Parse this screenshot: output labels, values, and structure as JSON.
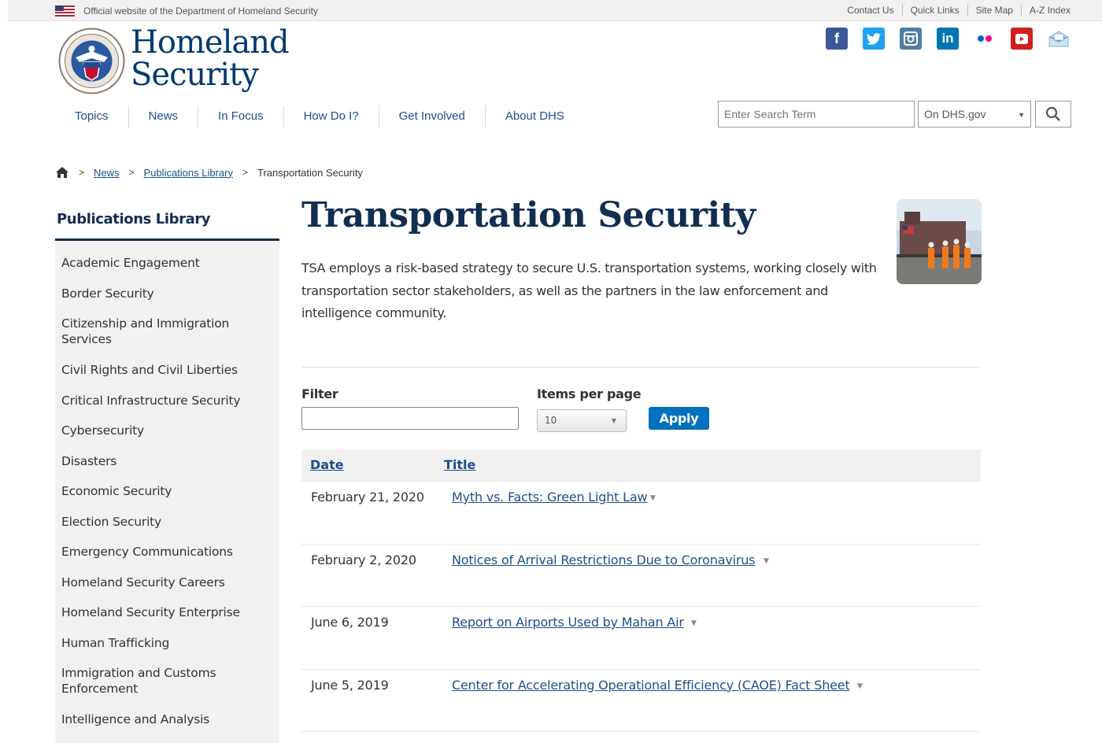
{
  "topbar": {
    "official_text": "Official website of the Department of Homeland Security",
    "links": [
      "Contact Us",
      "Quick Links",
      "Site Map",
      "A-Z Index"
    ]
  },
  "header": {
    "logo_line1": "Homeland",
    "logo_line2": "Security",
    "social": [
      {
        "name": "facebook-icon",
        "glyph": "f",
        "color": "#3b5998"
      },
      {
        "name": "twitter-icon",
        "glyph": "t",
        "color": "#1da1f2"
      },
      {
        "name": "instagram-icon",
        "glyph": "◎",
        "color": "#517fa4"
      },
      {
        "name": "linkedin-icon",
        "glyph": "in",
        "color": "#0077b5"
      },
      {
        "name": "flickr-icon",
        "glyph": "",
        "color": "#ffffff"
      },
      {
        "name": "youtube-icon",
        "glyph": "▶",
        "color": "#cd201f"
      },
      {
        "name": "email-icon",
        "glyph": "✉",
        "color": "#ffffff"
      }
    ]
  },
  "nav": {
    "items": [
      "Topics",
      "News",
      "In Focus",
      "How Do I?",
      "Get Involved",
      "About DHS"
    ]
  },
  "search": {
    "placeholder": "Enter Search Term",
    "scope": "On DHS.gov"
  },
  "breadcrumb": {
    "news": "News",
    "publications": "Publications Library",
    "current": "Transportation Security"
  },
  "sidebar": {
    "title": "Publications Library",
    "items": [
      "Academic Engagement",
      "Border Security",
      "Citizenship and Immigration Services",
      "Civil Rights and Civil Liberties",
      "Critical Infrastructure Security",
      "Cybersecurity",
      "Disasters",
      "Economic Security",
      "Election Security",
      "Emergency Communications",
      "Homeland Security Careers",
      "Homeland Security Enterprise",
      "Human Trafficking",
      "Immigration and Customs Enforcement",
      "Intelligence and Analysis"
    ]
  },
  "main": {
    "title": "Transportation Security",
    "intro": "TSA employs a risk-based strategy to secure U.S. transportation systems, working closely with transportation sector stakeholders, as well as the partners in the law enforcement and intelligence community."
  },
  "filters": {
    "filter_label": "Filter",
    "filter_value": "",
    "ipp_label": "Items per page",
    "ipp_value": "10",
    "apply_label": "Apply"
  },
  "table": {
    "headers": {
      "date": "Date",
      "title": "Title"
    },
    "rows": [
      {
        "date": "February 21, 2020",
        "title": "Myth vs. Facts: Green Light Law"
      },
      {
        "date": "February 2, 2020",
        "title": "Notices of Arrival Restrictions Due to Coronavirus"
      },
      {
        "date": "June 6, 2019",
        "title": "Report on Airports Used by Mahan Air"
      },
      {
        "date": "June 5, 2019",
        "title": "Center for Accelerating Operational Efficiency (CAOE) Fact Sheet"
      }
    ]
  }
}
